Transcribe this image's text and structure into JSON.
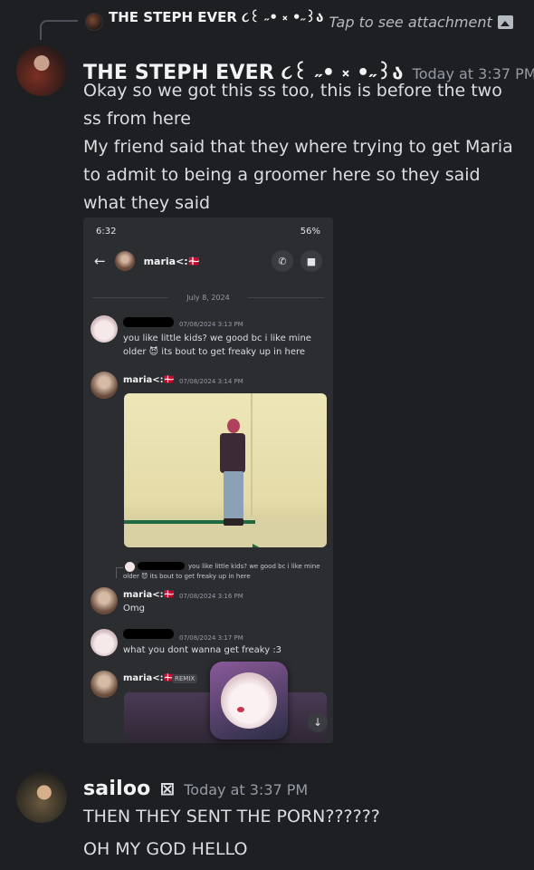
{
  "reply": {
    "username": "THE STEPH EVER ૮꒰ ˶• ༝ •˶꒱ა",
    "text": "Tap to see attachment"
  },
  "message1": {
    "username": "THE STEPH EVER ૮꒰ ˶• ༝ •˶꒱ა",
    "timestamp": "Today at 3:37 PM",
    "paragraph1": "Okay so we got this ss too, this is before the two ss from here",
    "paragraph2": "My friend said that they where trying to get Maria to admit to being a groomer here so they said what they said"
  },
  "screenshot": {
    "status_time": "6:32",
    "status_battery": "56%",
    "chat_name": "maria<:🇩🇰",
    "date_divider": "July 8, 2024",
    "msg1_time": "07/08/2024 3:13 PM",
    "msg1_text": "you like little kids? we good bc i like mine older 😈 its bout to get freaky up in here",
    "msg2_name": "maria<:🇩🇰",
    "msg2_time": "07/08/2024 3:14 PM",
    "reply_quote_line1": "you like little kids? we good bc i like mine",
    "reply_quote_line2": "older 😈 its bout to get freaky up in here",
    "msg3_name": "maria<:🇩🇰",
    "msg3_time": "07/08/2024 3:16 PM",
    "msg3_text": "Omg",
    "msg4_time": "07/08/2024 3:17 PM",
    "msg4_text": "what you dont wanna get freaky :3",
    "msg5_name": "maria<:🇩🇰",
    "msg5_badge": "REMIX"
  },
  "message2": {
    "username": "sailoo",
    "badge": "⊠",
    "timestamp": "Today at 3:37 PM",
    "line1": "THEN THEY SENT THE PORN??????",
    "line2": "OH MY GOD HELLO"
  },
  "icons": [
    "reply-avatar",
    "image-icon",
    "back-arrow-icon",
    "call-icon",
    "video-icon",
    "scroll-down-icon"
  ],
  "colors": {
    "background": "#1e1f22",
    "text": "#dbdee1",
    "muted": "#949ba4",
    "embed_bg": "#2b2d31"
  }
}
